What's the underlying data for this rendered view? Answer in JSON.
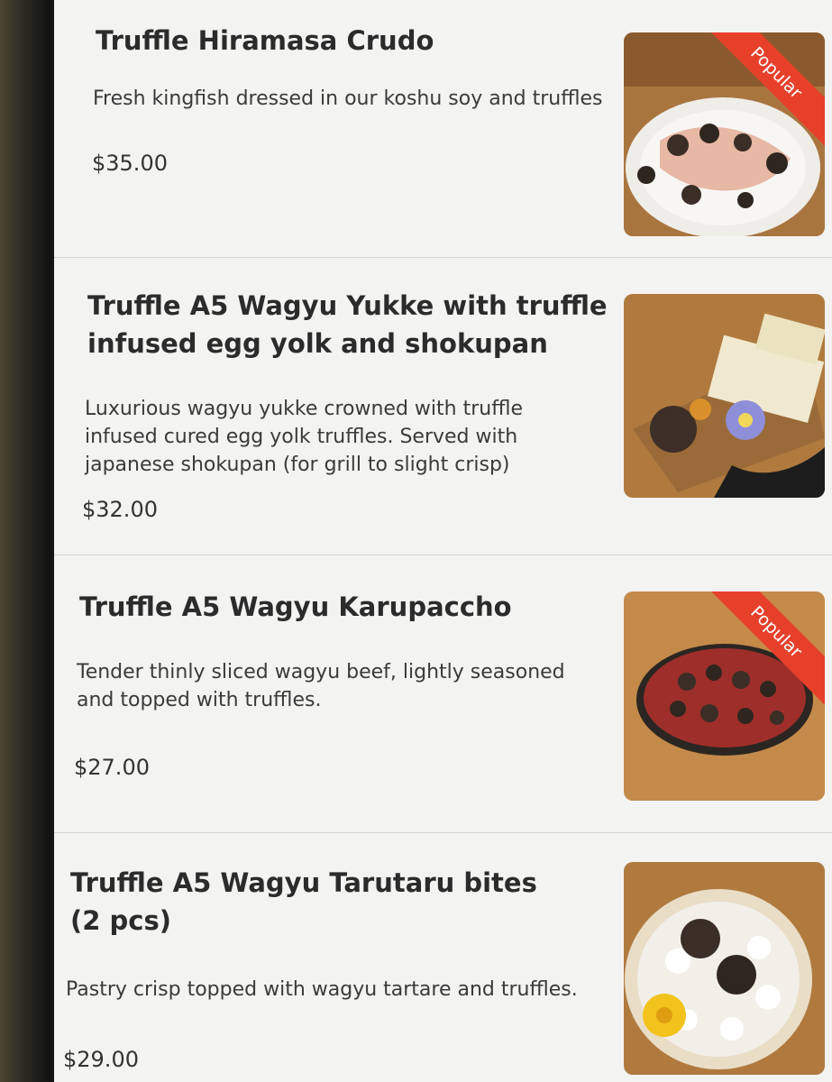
{
  "menu": {
    "items": [
      {
        "title": "Truffle Hiramasa Crudo",
        "description": "Fresh kingfish dressed in our koshu soy and truffles",
        "price": "$35.00",
        "badge": "Popular"
      },
      {
        "title": "Truffle A5 Wagyu Yukke with truffle infused egg yolk and shokupan",
        "description": "Luxurious wagyu yukke crowned with truffle infused cured egg yolk truffles. Served with japanese shokupan (for grill to slight crisp)",
        "price": "$32.00"
      },
      {
        "title": "Truffle A5 Wagyu Karupaccho",
        "description": "Tender thinly sliced wagyu beef, lightly seasoned and topped with truffles.",
        "price": "$27.00",
        "badge": "Popular"
      },
      {
        "title": "Truffle A5 Wagyu Tarutaru bites (2 pcs)",
        "description": "Pastry crisp topped with wagyu tartare and truffles.",
        "price": "$29.00"
      }
    ]
  },
  "colors": {
    "badge": "#e6402b",
    "background": "#f3f3f1",
    "text": "#2b2b2b"
  },
  "icons": [
    "dish-photo"
  ]
}
